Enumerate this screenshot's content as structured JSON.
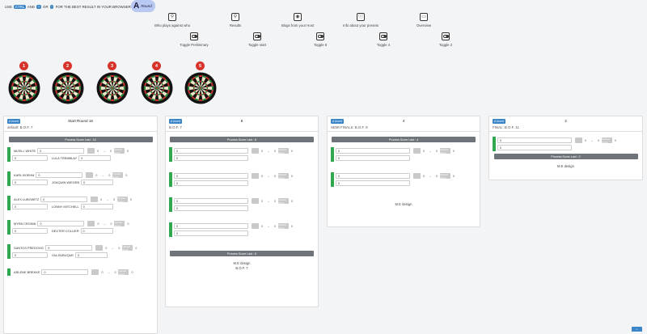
{
  "tip": {
    "pre": "USE",
    "k1": "CTRL",
    "mid": "AND",
    "k2": "+",
    "or": "OR",
    "k3": "-",
    "post": "FOR THE BEST RESULT IN YOUR BROWSER"
  },
  "pill": {
    "letter": "A",
    "label": "Round"
  },
  "top_icons": [
    {
      "label": "Who plays against who",
      "icon": "network-icon"
    },
    {
      "label": "Results",
      "icon": "network-icon"
    },
    {
      "label": "Blogs from your Host",
      "icon": "broadcast-icon"
    },
    {
      "label": "Info about your presets",
      "icon": "info-icon"
    },
    {
      "label": "Overview",
      "icon": "overview-icon"
    }
  ],
  "toggles": [
    "Toggle Preliminary",
    "Toggle start",
    "Toggle 8",
    "Toggle 4",
    "Toggle 2"
  ],
  "dartboards": [
    "1",
    "2",
    "3",
    "4",
    "5"
  ],
  "col1": {
    "badge": "A round",
    "title": "Start Round 16",
    "sub": "default: B.O.F. 7",
    "process": "Process Score Last : 16",
    "footer": "",
    "players": [
      [
        "MIZELL WHITE",
        "0",
        "0",
        "0",
        "0",
        "0"
      ],
      [
        "LULA TREMBLAY",
        "0",
        "",
        "",
        "",
        ""
      ],
      [
        "KARL BOEHM",
        "0",
        "0",
        "0",
        "0",
        "0"
      ],
      [
        "JOAQUIN WIEGEB",
        "0",
        "",
        "",
        "",
        ""
      ],
      [
        "ALEX LUBOWITZ",
        "0",
        "0",
        "0",
        "0",
        "0"
      ],
      [
        "LONNY MITCHELL",
        "0",
        "",
        "",
        "",
        ""
      ],
      [
        "MYRA CRONIN",
        "0",
        "0",
        "0",
        "0",
        "0"
      ],
      [
        "DEXTER COLLIER",
        "0",
        "",
        "",
        "",
        ""
      ],
      [
        "SANTOS PREDOVIC",
        "0",
        "0",
        "0",
        "0",
        "0"
      ],
      [
        "GIA DUBUQUE",
        "0",
        "",
        "",
        "",
        ""
      ],
      [
        "ARLENE BREKKE",
        "0",
        "0",
        "0",
        "0",
        "0"
      ]
    ]
  },
  "col2": {
    "badge": "A round",
    "title": "8",
    "sub": "B.O.F. 7",
    "process": "Process Score Last : 8",
    "footer1": "M.E design",
    "footer2": "B.O.F. 7"
  },
  "col3": {
    "badge": "A round",
    "title": "4",
    "sub": "SEMI FINALS: B.O.F. 9",
    "process": "Process Score Last : 4",
    "footer1": "M.E design"
  },
  "col4": {
    "badge": "A round",
    "title": "2",
    "sub": "FINAL: B.O.F. 11",
    "process": "Process Score Last : 2",
    "footer1": "M.E design"
  },
  "labels": {
    "zero": "0",
    "dash": "–",
    "upload": "Upload Score",
    "up": "^"
  }
}
